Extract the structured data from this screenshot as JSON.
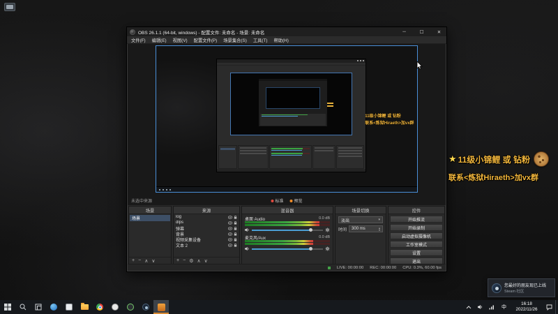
{
  "desktop": {
    "overlay": {
      "star": "★",
      "line1": "11级小锦鲤 或 钻粉",
      "line2": "联系<炼狱Hiraeth>加vx群"
    },
    "toast": {
      "line1": "您最好的朋友现已上线",
      "line2": "Steam 社区"
    }
  },
  "obs": {
    "title": "OBS 26.1.1 (64-bit, windows) - 配置文件: 未命名 - 场景: 未命名",
    "window_controls": {
      "minimize": "─",
      "maximize": "☐",
      "close": "✕"
    },
    "menu": [
      "文件(F)",
      "编辑(E)",
      "视图(V)",
      "配置文件(P)",
      "场景集合(S)",
      "工具(T)",
      "帮助(H)"
    ],
    "source_toolbar": {
      "no_source": "未选中来源",
      "badge1": "标准",
      "badge2": "预览"
    },
    "scenes": {
      "title": "场景",
      "items": [
        "场景"
      ],
      "footer": [
        "+",
        "−",
        "∧",
        "∨"
      ]
    },
    "sources": {
      "title": "来源",
      "items": [
        "log",
        "dlps",
        "弹幕",
        "背景",
        "视频采集设备",
        "文本 2"
      ],
      "footer": [
        "+",
        "−",
        "⚙",
        "∧",
        "∨"
      ]
    },
    "mixer": {
      "title": "混音器",
      "channels": [
        {
          "name": "桌面 Audio",
          "db": "0.0 dB",
          "level": 0.88
        },
        {
          "name": "麦克风/Aux",
          "db": "0.0 dB",
          "level": 0.8
        }
      ]
    },
    "transitions": {
      "title": "场景切换",
      "selected": "淡出",
      "duration_label": "时间",
      "duration": "300 ms"
    },
    "controls": {
      "title": "控件",
      "buttons": [
        "开始推流",
        "开始录制",
        "启动虚拟摄像机",
        "工作室模式",
        "设置",
        "退出"
      ]
    },
    "statusbar": {
      "items": [
        "LIVE: 00:00:00",
        "REC: 00:00:00",
        "CPU: 0.3%, 60.00 fps"
      ]
    }
  },
  "icons": {
    "dropdown_arrow": "▾",
    "spinner_up": "▴",
    "spinner_down": "▾"
  },
  "taskbar": {
    "apps": [
      "browser",
      "app-window",
      "file-explorer",
      "chrome",
      "app-light",
      "nvidia",
      "steam",
      "obs-active"
    ],
    "tray": {
      "lang": "中",
      "time": "16:18",
      "date": "2022/11/26"
    }
  }
}
